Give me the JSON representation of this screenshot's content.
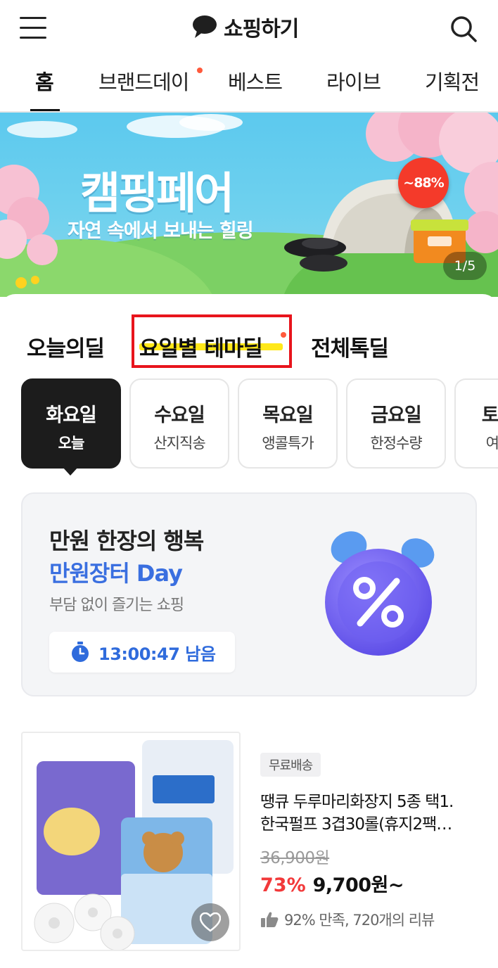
{
  "header": {
    "brand_title": "쇼핑하기"
  },
  "top_nav": {
    "tabs": [
      {
        "label": "홈",
        "active": true
      },
      {
        "label": "브랜드데이",
        "new_dot": true
      },
      {
        "label": "베스트"
      },
      {
        "label": "라이브"
      },
      {
        "label": "기획전"
      }
    ]
  },
  "banner": {
    "title": "캠핑페어",
    "subtitle": "자연 속에서 보내는 힐링",
    "discount_badge": "~88%",
    "page_indicator": "1/5"
  },
  "deal_tabs": [
    {
      "label": "오늘의딜"
    },
    {
      "label": "요일별 테마딜",
      "active": true,
      "new_dot": true
    },
    {
      "label": "전체톡딜"
    }
  ],
  "day_chips": [
    {
      "day": "화요일",
      "sub": "오늘",
      "active": true
    },
    {
      "day": "수요일",
      "sub": "산지직송"
    },
    {
      "day": "목요일",
      "sub": "앵콜특가"
    },
    {
      "day": "금요일",
      "sub": "한정수량"
    },
    {
      "day": "토/일",
      "sub": "여행"
    }
  ],
  "promo": {
    "line1": "만원 한장의 행복",
    "line2": "만원장터 Day",
    "line3": "부담 없이 즐기는 쇼핑",
    "timer": "13:00:47 남음"
  },
  "product": {
    "badge": "무료배송",
    "title_line1": "땡큐 두루마리화장지 5종 택1.",
    "title_line2": "한국펄프 3겹30롤(휴지2팩…",
    "original_price": "36,900원",
    "discount_rate": "73%",
    "price": "9,700원~",
    "review": "92% 만족, 720개의 리뷰"
  },
  "colors": {
    "accent_red": "#f2393a",
    "accent_blue": "#3a6fe0",
    "highlight_yellow": "#ffe600",
    "selection_box": "#e8141c"
  }
}
